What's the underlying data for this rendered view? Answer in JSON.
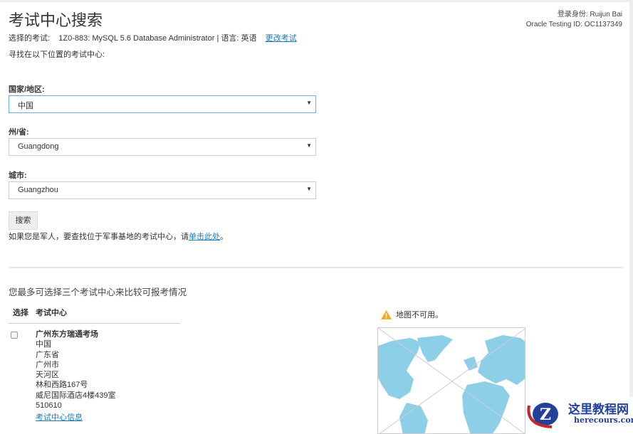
{
  "header": {
    "title": "考试中心搜索",
    "user_label": "登录身份: Ruijun Bai",
    "testing_id": "Oracle Testing ID: OC1137349"
  },
  "exam": {
    "label": "选择的考试:",
    "value": "1Z0-883: MySQL 5.6 Database Administrator | 语言: 英语",
    "change_link": "更改考试"
  },
  "intro": "寻找在以下位置的考试中心:",
  "form": {
    "country_label": "国家/地区:",
    "country_value": "中国",
    "state_label": "州/省:",
    "state_value": "Guangdong",
    "city_label": "城市:",
    "city_value": "Guangzhou",
    "search_button": "搜索",
    "military_text": "如果您是军人，要查找位于军事基地的考试中心，请",
    "military_link": "单击此处",
    "military_end": "。"
  },
  "results": {
    "heading": "您最多可选择三个考试中心来比较可报考情况",
    "col_select": "选择",
    "col_center": "考试中心",
    "centers": [
      {
        "name": "广州东方瑞通考场",
        "lines": [
          "中国",
          "广东省",
          "广州市",
          "天河区",
          "林和西路167号",
          "威尼国际酒店4楼439室",
          "510610"
        ],
        "info_link": "考试中心信息"
      }
    ]
  },
  "map": {
    "warning": "地图不可用。",
    "land_color": "#8ecfe8",
    "warning_color": "#f0ad1e"
  },
  "watermark": {
    "cn": "这里教程网",
    "en": "herecours.com"
  }
}
